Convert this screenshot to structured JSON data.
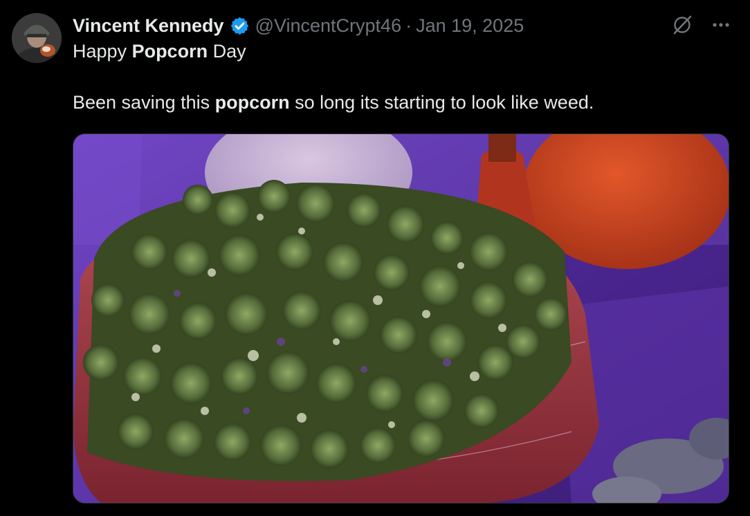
{
  "tweet": {
    "author": {
      "display_name": "Vincent Kennedy",
      "handle": "@VincentCrypt46",
      "verified": true,
      "avatar_icon": "user-avatar"
    },
    "separator": "·",
    "date": "Jan 19, 2025",
    "text_line1": {
      "pre": "Happy ",
      "bold": "Popcorn",
      "post": " Day"
    },
    "text_line2": {
      "pre": "Been saving this ",
      "bold": "popcorn",
      "post": " so long its starting to look like weed."
    },
    "media": {
      "type": "photo",
      "icon": "photo-popcorn-bowl"
    },
    "actions": {
      "grok_icon": "grok-icon",
      "more_icon": "more-horizontal-icon"
    }
  },
  "colors": {
    "background": "#000000",
    "text_primary": "#e7e9ea",
    "text_secondary": "#71767b",
    "verified_badge": "#1d9bf0",
    "border": "#2f3336"
  }
}
